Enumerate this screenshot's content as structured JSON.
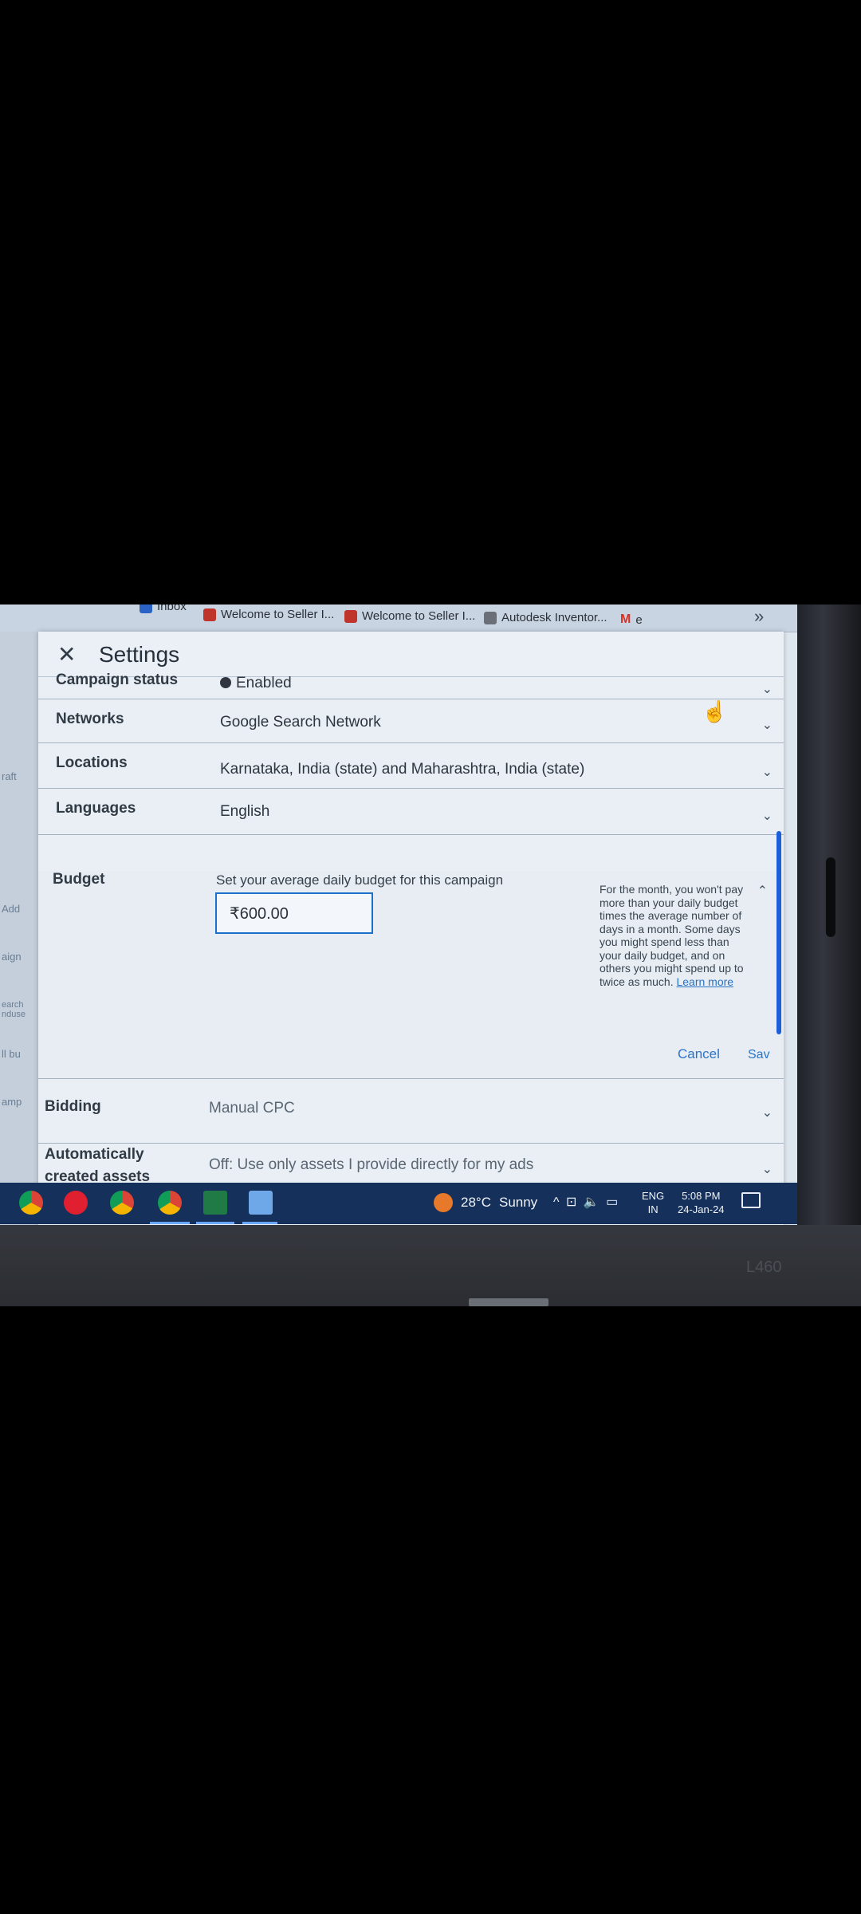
{
  "bookmarks": {
    "items": [
      {
        "label": "Inbox",
        "icon": "windows-live-mail-icon"
      },
      {
        "label": "Welcome to Seller I...",
        "icon": "seller-logo-icon"
      },
      {
        "label": "Welcome to Seller I...",
        "icon": "seller-logo-icon"
      },
      {
        "label": "Autodesk Inventor...",
        "icon": "autodesk-icon"
      },
      {
        "label": "e",
        "icon": "gmail-icon"
      }
    ],
    "more_label": "»"
  },
  "left_strip": {
    "texts": [
      "raft",
      "Add",
      "aign",
      "earch nduse",
      "ll bu",
      "amp"
    ]
  },
  "dialog": {
    "close_glyph": "✕",
    "title": "Settings"
  },
  "rows": {
    "campaign_status": {
      "label": "Campaign status",
      "value": "Enabled"
    },
    "networks": {
      "label": "Networks",
      "value": "Google Search Network"
    },
    "locations": {
      "label": "Locations",
      "value": "Karnataka, India (state) and Maharashtra, India (state)"
    },
    "languages": {
      "label": "Languages",
      "value": "English"
    },
    "bidding": {
      "label": "Bidding",
      "value": "Manual CPC"
    },
    "auto_assets": {
      "label_line1": "Automatically",
      "label_line2": "created assets",
      "value": "Off: Use only assets I provide directly for my ads"
    }
  },
  "budget": {
    "label": "Budget",
    "description": "Set your average daily budget for this campaign",
    "input_value": "₹600.00",
    "help_text": "For the month, you won't pay more than your daily budget times the average number of days in a month. Some days you might spend less than your daily budget, and on others you might spend up to twice as much.",
    "learn_more": "Learn more",
    "cancel_label": "Cancel",
    "save_label": "Sav"
  },
  "taskbar": {
    "apps": [
      "chrome-icon",
      "opera-icon",
      "chrome-profile-icon",
      "chrome-active-icon",
      "excel-icon",
      "notepad-icon"
    ],
    "weather": {
      "temp": "28°C",
      "condition": "Sunny"
    },
    "tray_icons": "^ ⊡ 🔈 ▭",
    "lang_line1": "ENG",
    "lang_line2": "IN",
    "time": "5:08 PM",
    "date": "24-Jan-24"
  },
  "bezel": {
    "model": "L460"
  },
  "colors": {
    "accent_blue": "#2a74c9",
    "taskbar_bg": "#15305a"
  }
}
